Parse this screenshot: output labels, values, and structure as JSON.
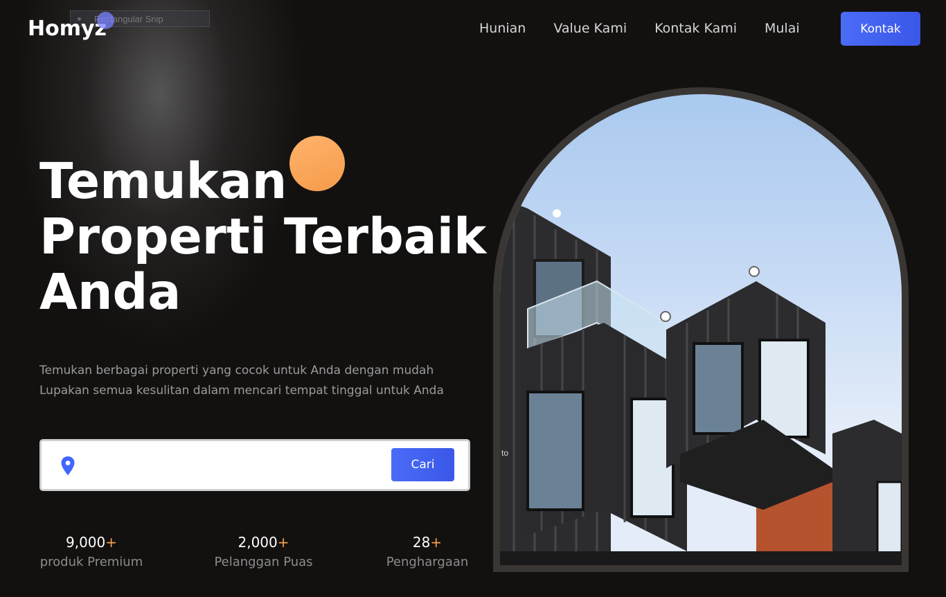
{
  "overlay": {
    "snip_label": "Rectangular Snip"
  },
  "brand": {
    "logo": "Homyz"
  },
  "nav": {
    "items": [
      "Hunian",
      "Value Kami",
      "Kontak Kami",
      "Mulai"
    ],
    "cta_label": "Kontak"
  },
  "hero": {
    "title_lines": [
      "Temukan",
      "Properti Terbaik",
      "Anda"
    ],
    "description_lines": [
      "Temukan berbagai properti yang cocok untuk Anda dengan mudah",
      "Lupakan semua kesulitan dalam mencari tempat tinggal untuk Anda"
    ],
    "image_caption": "to"
  },
  "search": {
    "value": "",
    "placeholder": "",
    "button_label": "Cari",
    "icon": "location-pin-icon"
  },
  "stats": [
    {
      "value": "9,000",
      "suffix": "+",
      "label": "produk Premium"
    },
    {
      "value": "2,000",
      "suffix": "+",
      "label": "Pelanggan Puas"
    },
    {
      "value": "28",
      "suffix": "+",
      "label": "Penghargaan"
    }
  ],
  "colors": {
    "background": "#131110",
    "accent_blue": "#4066ff",
    "accent_orange": "#ffa852"
  }
}
